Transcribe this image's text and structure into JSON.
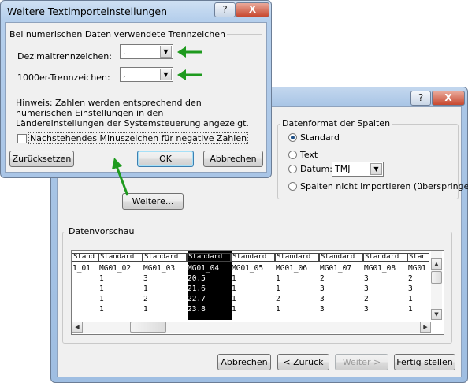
{
  "options_dialog": {
    "title": "Weitere Textimporteinstellungen",
    "help_button": "?",
    "close_button": "X",
    "group_label": "Bei numerischen Daten verwendete Trennzeichen",
    "decimal_label": "Dezimaltrennzeichen:",
    "decimal_value": ".",
    "thousands_label": "1000er-Trennzeichen:",
    "thousands_value": ",",
    "hint": "Hinweis: Zahlen werden entsprechend den numerischen Einstellungen in den Ländereinstellungen der Systemsteuerung angezeigt.",
    "checkbox_label": "Nachstehendes Minuszeichen für negative Zahlen",
    "checkbox_checked": false,
    "reset_button": "Zurücksetzen",
    "ok_button": "OK",
    "cancel_button": "Abbrechen"
  },
  "wizard": {
    "help_button": "?",
    "close_button": "X",
    "format_group_label": "Datenformat der Spalten",
    "format_options": [
      "Standard",
      "Text",
      "Datum:",
      "Spalten nicht importieren (überspringen)"
    ],
    "selected_format": "Standard",
    "date_format": "TMJ",
    "more_button": "Weitere...",
    "preview_label": "Datenvorschau",
    "preview": {
      "headers": [
        "Stand",
        "Standard",
        "Standard",
        "Standard",
        "Standard",
        "Standard",
        "Standard",
        "Standard",
        "Stan"
      ],
      "rows": [
        [
          "1_01",
          "MG01_02",
          "MG01_03",
          "MG01_04",
          "MG01_05",
          "MG01_06",
          "MG01_07",
          "MG01_08",
          "MG01"
        ],
        [
          "",
          "1",
          "3",
          "20.5",
          "1",
          "1",
          "2",
          "3",
          "2"
        ],
        [
          "",
          "1",
          "1",
          "21.6",
          "1",
          "1",
          "3",
          "3",
          "3"
        ],
        [
          "",
          "1",
          "2",
          "22.7",
          "1",
          "2",
          "3",
          "2",
          "1"
        ],
        [
          "",
          "1",
          "1",
          "23.8",
          "1",
          "1",
          "3",
          "3",
          "1"
        ]
      ],
      "selected_column": 3
    },
    "cancel_button": "Abbrechen",
    "back_button": "< Zurück",
    "next_button": "Weiter >",
    "finish_button": "Fertig stellen"
  },
  "colors": {
    "arrow": "#1e9a1e",
    "title_bar": "#a9c5e5",
    "selected_column": "#000000"
  }
}
